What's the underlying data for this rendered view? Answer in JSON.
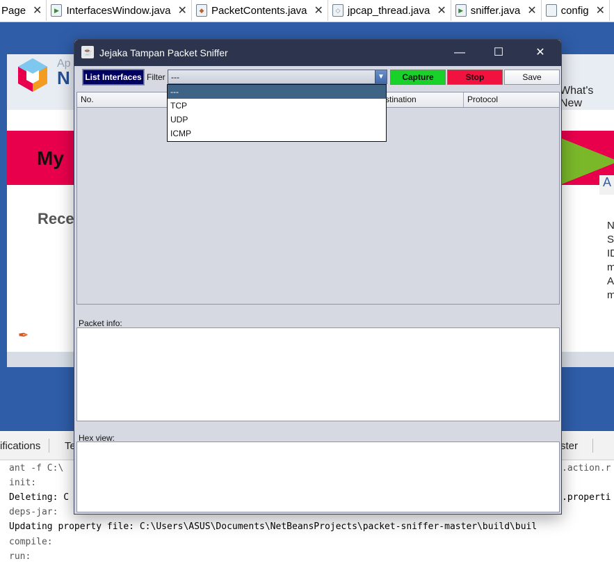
{
  "ide": {
    "tabs": [
      {
        "label": "Page",
        "icon": "none"
      },
      {
        "label": "InterfacesWindow.java",
        "icon": "java-file-icon"
      },
      {
        "label": "PacketContents.java",
        "icon": "java-class-icon"
      },
      {
        "label": "jpcap_thread.java",
        "icon": "java-class-icon"
      },
      {
        "label": "sniffer.java",
        "icon": "java-file-icon"
      },
      {
        "label": "config",
        "icon": "file-icon"
      }
    ],
    "start_page": {
      "header_small": "Ap",
      "header_big": "N",
      "whats_new": "What's New",
      "hero_title": "My",
      "recent": "Rece",
      "side_tab": "A",
      "side_text": [
        "N",
        "St",
        "ID",
        "m",
        "A",
        "m"
      ]
    },
    "output_tabs": [
      "ifications",
      "Te",
      "ster"
    ],
    "output_lines": [
      {
        "text": "ant -f C:\\",
        "style": "gray",
        "right": ".action.r"
      },
      {
        "text": "init:",
        "style": "gray",
        "right": ""
      },
      {
        "text": "Deleting: C",
        "style": "normal",
        "right": ".properti"
      },
      {
        "text": "deps-jar:",
        "style": "gray",
        "right": ""
      },
      {
        "text": "Updating property file: C:\\Users\\ASUS\\Documents\\NetBeansProjects\\packet-sniffer-master\\build\\buil",
        "style": "normal",
        "right": ""
      },
      {
        "text": "compile:",
        "style": "gray",
        "right": ""
      },
      {
        "text": "run:",
        "style": "gray",
        "right": ""
      }
    ]
  },
  "window": {
    "title": "Jejaka Tampan Packet Sniffer",
    "controls": {
      "minimize": "—",
      "maximize": "☐",
      "close": "✕"
    }
  },
  "toolbar": {
    "list_interfaces": "List Interfaces",
    "filter_label": "Filter",
    "filter_value": "---",
    "capture": "Capture",
    "stop": "Stop",
    "save": "Save"
  },
  "filter_options": [
    "---",
    "TCP",
    "UDP",
    "ICMP"
  ],
  "table": {
    "columns": [
      "No.",
      "stination",
      "Protocol"
    ]
  },
  "panels": {
    "packet_info": "Packet info:",
    "hex_view": "Hex view:"
  },
  "colors": {
    "title_bar": "#2c344e",
    "list_interfaces_bg": "#000060",
    "capture_bg": "#18d22a",
    "stop_bg": "#f2123f",
    "window_bg": "#d6d9e1",
    "dropdown_selected": "#3e6384"
  }
}
